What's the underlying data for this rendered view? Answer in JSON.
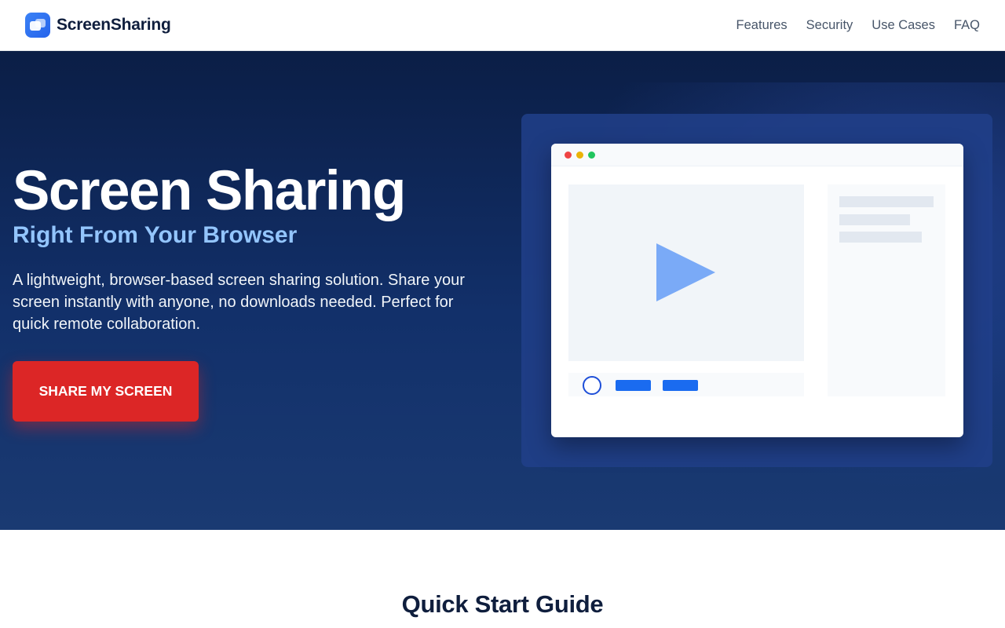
{
  "header": {
    "brand": "ScreenSharing",
    "nav": [
      {
        "label": "Features"
      },
      {
        "label": "Security"
      },
      {
        "label": "Use Cases"
      },
      {
        "label": "FAQ"
      }
    ]
  },
  "hero": {
    "title": "Screen Sharing",
    "subtitle": "Right From Your Browser",
    "description": "A lightweight, browser-based screen sharing solution. Share your screen instantly with anyone, no downloads needed. Perfect for quick remote collaboration.",
    "cta_label": "SHARE MY SCREEN"
  },
  "mockup": {
    "icons": [
      "window-dot-red",
      "window-dot-yellow",
      "window-dot-green",
      "play-icon"
    ]
  },
  "quick_start": {
    "title": "Quick Start Guide"
  },
  "colors": {
    "primary": "#2563eb",
    "cta": "#dc2626",
    "hero_bg": "#0b1e46",
    "accent_text": "#93c5fd"
  }
}
